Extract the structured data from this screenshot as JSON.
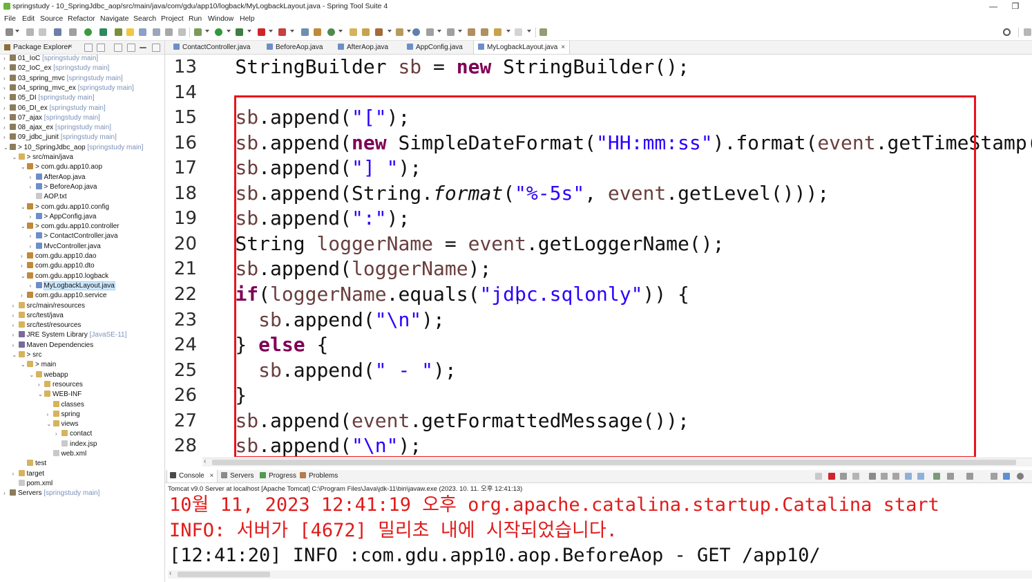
{
  "window": {
    "title": "springstudy - 10_SpringJdbc_aop/src/main/java/com/gdu/app10/logback/MyLogbackLayout.java - Spring Tool Suite 4",
    "minimize": "—",
    "restore": "❐"
  },
  "menu": [
    "File",
    "Edit",
    "Source",
    "Refactor",
    "Navigate",
    "Search",
    "Project",
    "Run",
    "Window",
    "Help"
  ],
  "package_explorer": {
    "title": "Package Explorer",
    "close": "×",
    "items": [
      {
        "name": "01_IoC",
        "suffix": " [springstudy main]",
        "depth": 0,
        "arrow": "›",
        "icon": "project"
      },
      {
        "name": "02_IoC_ex",
        "suffix": " [springstudy main]",
        "depth": 0,
        "arrow": "›",
        "icon": "project"
      },
      {
        "name": "03_spring_mvc",
        "suffix": " [springstudy main]",
        "depth": 0,
        "arrow": "›",
        "icon": "project"
      },
      {
        "name": "04_spring_mvc_ex",
        "suffix": " [springstudy main]",
        "depth": 0,
        "arrow": "›",
        "icon": "project"
      },
      {
        "name": "05_DI",
        "suffix": " [springstudy main]",
        "depth": 0,
        "arrow": "›",
        "icon": "project"
      },
      {
        "name": "06_DI_ex",
        "suffix": " [springstudy main]",
        "depth": 0,
        "arrow": "›",
        "icon": "project"
      },
      {
        "name": "07_ajax",
        "suffix": " [springstudy main]",
        "depth": 0,
        "arrow": "›",
        "icon": "project"
      },
      {
        "name": "08_ajax_ex",
        "suffix": " [springstudy main]",
        "depth": 0,
        "arrow": "›",
        "icon": "project"
      },
      {
        "name": "09_jdbc_junit",
        "suffix": " [springstudy main]",
        "depth": 0,
        "arrow": "›",
        "icon": "project"
      },
      {
        "name": "> 10_SpringJdbc_aop",
        "suffix": " [springstudy main]",
        "depth": 0,
        "arrow": "⌄",
        "icon": "project"
      },
      {
        "name": "> src/main/java",
        "suffix": "",
        "depth": 1,
        "arrow": "⌄",
        "icon": "folder"
      },
      {
        "name": "> com.gdu.app10.aop",
        "suffix": "",
        "depth": 2,
        "arrow": "⌄",
        "icon": "package"
      },
      {
        "name": "AfterAop.java",
        "suffix": "",
        "depth": 3,
        "arrow": "›",
        "icon": "java"
      },
      {
        "name": "> BeforeAop.java",
        "suffix": "",
        "depth": 3,
        "arrow": "›",
        "icon": "java"
      },
      {
        "name": "AOP.txt",
        "suffix": "",
        "depth": 3,
        "arrow": "",
        "icon": "file"
      },
      {
        "name": "> com.gdu.app10.config",
        "suffix": "",
        "depth": 2,
        "arrow": "⌄",
        "icon": "package"
      },
      {
        "name": "> AppConfig.java",
        "suffix": "",
        "depth": 3,
        "arrow": "›",
        "icon": "java"
      },
      {
        "name": "> com.gdu.app10.controller",
        "suffix": "",
        "depth": 2,
        "arrow": "⌄",
        "icon": "package"
      },
      {
        "name": "> ContactController.java",
        "suffix": "",
        "depth": 3,
        "arrow": "›",
        "icon": "java"
      },
      {
        "name": "MvcController.java",
        "suffix": "",
        "depth": 3,
        "arrow": "›",
        "icon": "java"
      },
      {
        "name": "com.gdu.app10.dao",
        "suffix": "",
        "depth": 2,
        "arrow": "›",
        "icon": "package"
      },
      {
        "name": "com.gdu.app10.dto",
        "suffix": "",
        "depth": 2,
        "arrow": "›",
        "icon": "package"
      },
      {
        "name": "com.gdu.app10.logback",
        "suffix": "",
        "depth": 2,
        "arrow": "⌄",
        "icon": "package"
      },
      {
        "name": "MyLogbackLayout.java",
        "suffix": "",
        "depth": 3,
        "arrow": "›",
        "icon": "java",
        "selected": true
      },
      {
        "name": "com.gdu.app10.service",
        "suffix": "",
        "depth": 2,
        "arrow": "›",
        "icon": "package"
      },
      {
        "name": "src/main/resources",
        "suffix": "",
        "depth": 1,
        "arrow": "›",
        "icon": "folder"
      },
      {
        "name": "src/test/java",
        "suffix": "",
        "depth": 1,
        "arrow": "›",
        "icon": "folder"
      },
      {
        "name": "src/test/resources",
        "suffix": "",
        "depth": 1,
        "arrow": "›",
        "icon": "folder"
      },
      {
        "name": "JRE System Library",
        "suffix": " [JavaSE-11]",
        "depth": 1,
        "arrow": "›",
        "icon": "lib"
      },
      {
        "name": "Maven Dependencies",
        "suffix": "",
        "depth": 1,
        "arrow": "›",
        "icon": "lib"
      },
      {
        "name": "> src",
        "suffix": "",
        "depth": 1,
        "arrow": "⌄",
        "icon": "folder"
      },
      {
        "name": "> main",
        "suffix": "",
        "depth": 2,
        "arrow": "⌄",
        "icon": "folder"
      },
      {
        "name": "webapp",
        "suffix": "",
        "depth": 3,
        "arrow": "⌄",
        "icon": "folder"
      },
      {
        "name": "resources",
        "suffix": "",
        "depth": 4,
        "arrow": "›",
        "icon": "folder"
      },
      {
        "name": "WEB-INF",
        "suffix": "",
        "depth": 4,
        "arrow": "⌄",
        "icon": "folder"
      },
      {
        "name": "classes",
        "suffix": "",
        "depth": 5,
        "arrow": "",
        "icon": "folder"
      },
      {
        "name": "spring",
        "suffix": "",
        "depth": 5,
        "arrow": "›",
        "icon": "folder"
      },
      {
        "name": "views",
        "suffix": "",
        "depth": 5,
        "arrow": "⌄",
        "icon": "folder"
      },
      {
        "name": "contact",
        "suffix": "",
        "depth": 6,
        "arrow": "›",
        "icon": "folder"
      },
      {
        "name": "index.jsp",
        "suffix": "",
        "depth": 6,
        "arrow": "",
        "icon": "file"
      },
      {
        "name": "web.xml",
        "suffix": "",
        "depth": 5,
        "arrow": "",
        "icon": "file"
      },
      {
        "name": "test",
        "suffix": "",
        "depth": 2,
        "arrow": "",
        "icon": "folder"
      },
      {
        "name": "target",
        "suffix": "",
        "depth": 1,
        "arrow": "›",
        "icon": "folder"
      },
      {
        "name": "pom.xml",
        "suffix": "",
        "depth": 1,
        "arrow": "",
        "icon": "file"
      },
      {
        "name": "Servers",
        "suffix": " [springstudy main]",
        "depth": 0,
        "arrow": "›",
        "icon": "project"
      }
    ]
  },
  "editor_tabs": [
    {
      "label": "ContactController.java",
      "active": false
    },
    {
      "label": "BeforeAop.java",
      "active": false
    },
    {
      "label": "AfterAop.java",
      "active": false
    },
    {
      "label": "AppConfig.java",
      "active": false
    },
    {
      "label": "MyLogbackLayout.java",
      "active": true
    }
  ],
  "code": {
    "lines": [
      {
        "number": "13",
        "tokens": [
          [
            "",
            "    StringBuilder "
          ],
          [
            "var",
            "sb"
          ],
          [
            "",
            " = "
          ],
          [
            "kw",
            "new"
          ],
          [
            "",
            " StringBuilder();"
          ]
        ]
      },
      {
        "number": "14",
        "tokens": []
      },
      {
        "number": "15",
        "tokens": [
          [
            "",
            "    "
          ],
          [
            "var",
            "sb"
          ],
          [
            "",
            ".append("
          ],
          [
            "str",
            "\"[\""
          ],
          [
            "",
            ");"
          ]
        ]
      },
      {
        "number": "16",
        "tokens": [
          [
            "",
            "    "
          ],
          [
            "var",
            "sb"
          ],
          [
            "",
            ".append("
          ],
          [
            "kw",
            "new"
          ],
          [
            "",
            " SimpleDateFormat("
          ],
          [
            "str",
            "\"HH:mm:ss\""
          ],
          [
            "",
            ").format("
          ],
          [
            "var",
            "event"
          ],
          [
            "",
            ".getTimeStamp()))"
          ]
        ]
      },
      {
        "number": "17",
        "tokens": [
          [
            "",
            "    "
          ],
          [
            "var",
            "sb"
          ],
          [
            "",
            ".append("
          ],
          [
            "str",
            "\"] \""
          ],
          [
            "",
            ");"
          ]
        ]
      },
      {
        "number": "18",
        "tokens": [
          [
            "",
            "    "
          ],
          [
            "var",
            "sb"
          ],
          [
            "",
            ".append(String."
          ],
          [
            "it",
            "format"
          ],
          [
            "",
            "("
          ],
          [
            "str",
            "\"%-5s\""
          ],
          [
            "",
            ", "
          ],
          [
            "var",
            "event"
          ],
          [
            "",
            ".getLevel()));"
          ]
        ]
      },
      {
        "number": "19",
        "tokens": [
          [
            "",
            "    "
          ],
          [
            "var",
            "sb"
          ],
          [
            "",
            ".append("
          ],
          [
            "str",
            "\":\""
          ],
          [
            "",
            ");"
          ]
        ]
      },
      {
        "number": "20",
        "tokens": [
          [
            "",
            "    String "
          ],
          [
            "var",
            "loggerName"
          ],
          [
            "",
            " = "
          ],
          [
            "var",
            "event"
          ],
          [
            "",
            ".getLoggerName();"
          ]
        ]
      },
      {
        "number": "21",
        "tokens": [
          [
            "",
            "    "
          ],
          [
            "var",
            "sb"
          ],
          [
            "",
            ".append("
          ],
          [
            "var",
            "loggerName"
          ],
          [
            "",
            ");"
          ]
        ]
      },
      {
        "number": "22",
        "tokens": [
          [
            "",
            "    "
          ],
          [
            "kw",
            "if"
          ],
          [
            "",
            "("
          ],
          [
            "var",
            "loggerName"
          ],
          [
            "",
            ".equals("
          ],
          [
            "str",
            "\"jdbc.sqlonly\""
          ],
          [
            "",
            ")) {"
          ]
        ]
      },
      {
        "number": "23",
        "tokens": [
          [
            "",
            "      "
          ],
          [
            "var",
            "sb"
          ],
          [
            "",
            ".append("
          ],
          [
            "str",
            "\"\\n\""
          ],
          [
            "",
            ");"
          ]
        ]
      },
      {
        "number": "24",
        "tokens": [
          [
            "",
            "    } "
          ],
          [
            "kw",
            "else"
          ],
          [
            "",
            " {"
          ]
        ]
      },
      {
        "number": "25",
        "tokens": [
          [
            "",
            "      "
          ],
          [
            "var",
            "sb"
          ],
          [
            "",
            ".append("
          ],
          [
            "str",
            "\" - \""
          ],
          [
            "",
            ");"
          ]
        ]
      },
      {
        "number": "26",
        "tokens": [
          [
            "",
            "    }"
          ]
        ]
      },
      {
        "number": "27",
        "tokens": [
          [
            "",
            "    "
          ],
          [
            "var",
            "sb"
          ],
          [
            "",
            ".append("
          ],
          [
            "var",
            "event"
          ],
          [
            "",
            ".getFormattedMessage());"
          ]
        ]
      },
      {
        "number": "28",
        "tokens": [
          [
            "",
            "    "
          ],
          [
            "var",
            "sb"
          ],
          [
            "",
            ".append("
          ],
          [
            "str",
            "\"\\n\""
          ],
          [
            "",
            ");"
          ]
        ]
      }
    ],
    "cursor_glyph": "I"
  },
  "bottom_panel": {
    "tabs": [
      {
        "label": "Console",
        "active": true,
        "close": "×"
      },
      {
        "label": "Servers",
        "active": false
      },
      {
        "label": "Progress",
        "active": false
      },
      {
        "label": "Problems",
        "active": false
      }
    ],
    "header": "Tomcat v9.0 Server at localhost [Apache Tomcat] C:\\Program Files\\Java\\jdk-11\\bin\\javaw.exe  (2023. 10. 11. 오후 12:41:13)",
    "lines": [
      {
        "text": "10월 11, 2023 12:41:19 오후 org.apache.catalina.startup.Catalina start",
        "color": "red"
      },
      {
        "text": "INFO: 서버가 [4672] 밀리초 내에 시작되었습니다.",
        "color": "red"
      },
      {
        "text": "[12:41:20] INFO :com.gdu.app10.aop.BeforeAop - GET /app10/",
        "color": "black"
      }
    ]
  },
  "colors": {
    "keyword": "#7f0055",
    "string": "#2a00ff",
    "variable": "#6a3e3e",
    "highlight_box": "#e8141c",
    "console_error": "#e01b1b"
  }
}
